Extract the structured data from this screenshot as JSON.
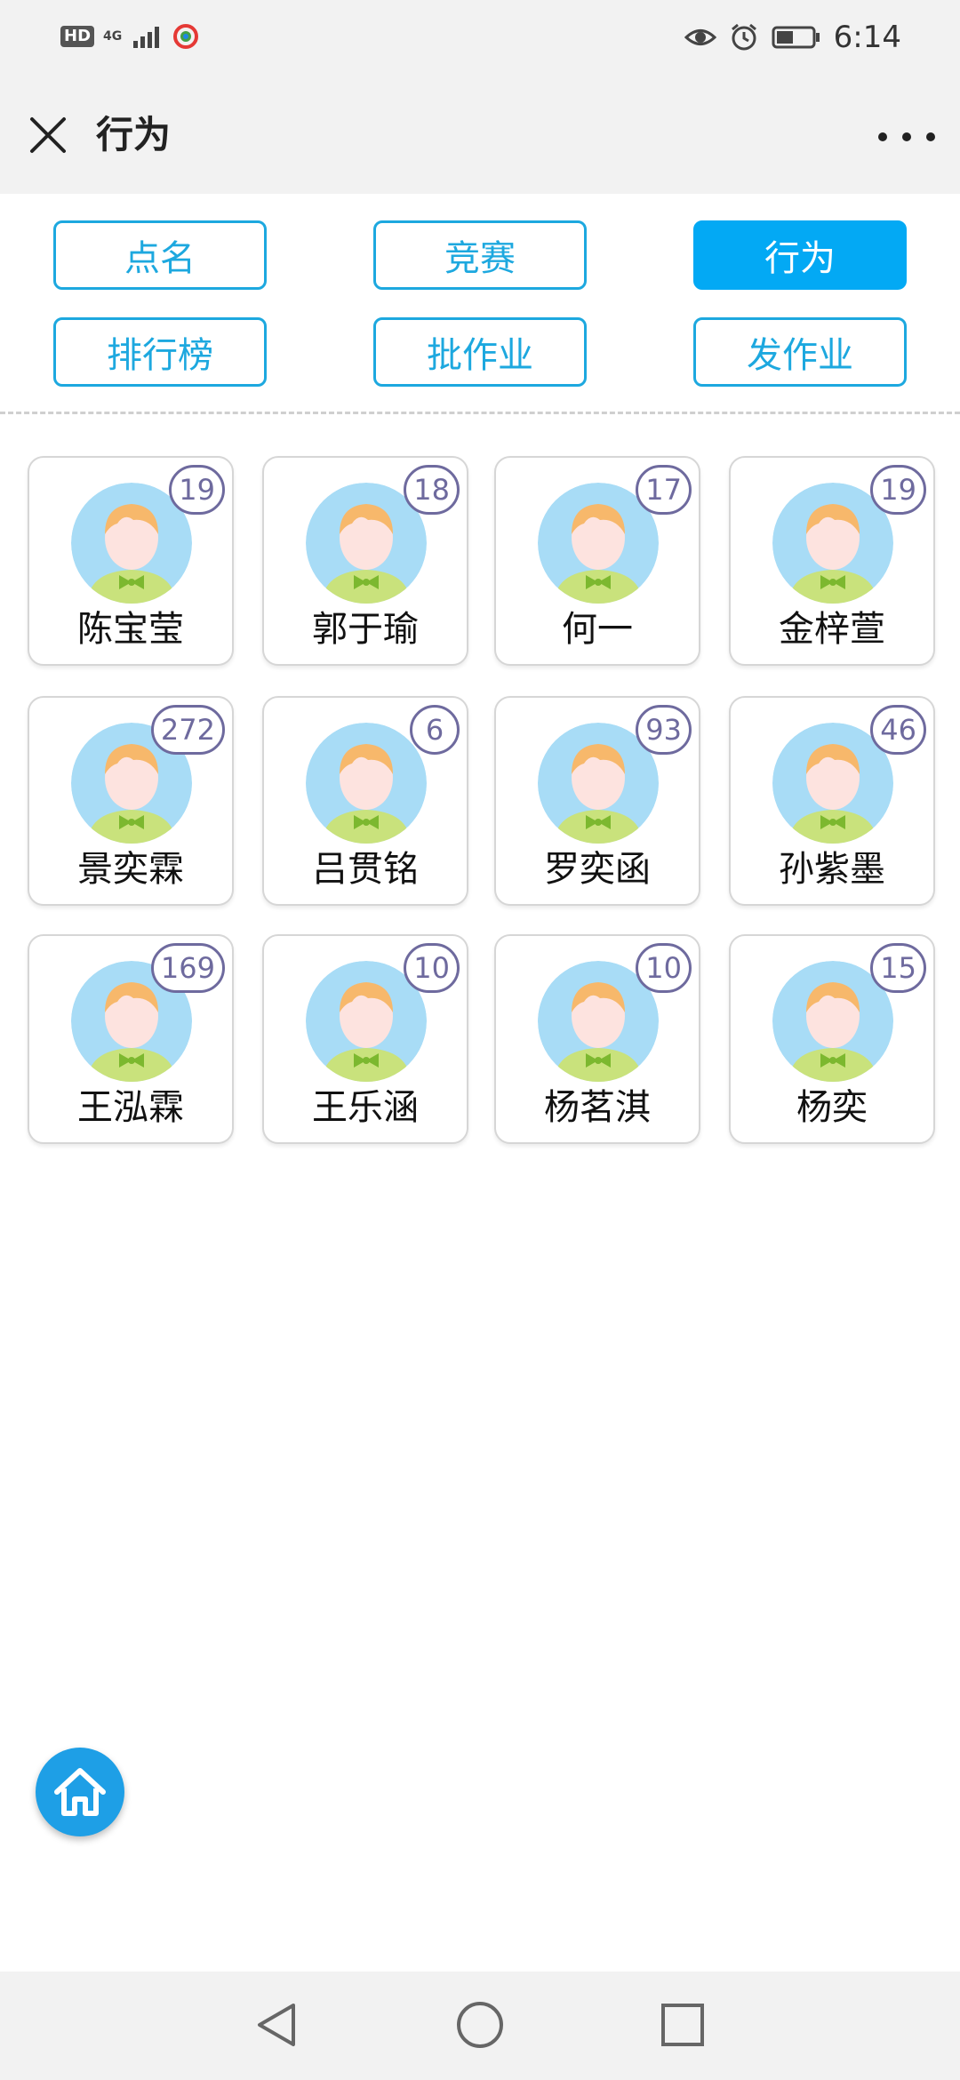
{
  "status_bar": {
    "hd": "HD",
    "network": "4G",
    "time": "6:14",
    "icons": [
      "signal-icon",
      "app-notification-icon",
      "eye-icon",
      "alarm-icon",
      "battery-icon"
    ]
  },
  "header": {
    "title": "行为",
    "close_icon": "close-icon",
    "more_icon": "more-icon"
  },
  "nav_buttons": [
    {
      "label": "点名",
      "active": false
    },
    {
      "label": "竞赛",
      "active": false
    },
    {
      "label": "行为",
      "active": true
    },
    {
      "label": "排行榜",
      "active": false
    },
    {
      "label": "批作业",
      "active": false
    },
    {
      "label": "发作业",
      "active": false
    }
  ],
  "students": [
    {
      "name": "陈宝莹",
      "count": "19"
    },
    {
      "name": "郭于瑜",
      "count": "18"
    },
    {
      "name": "何一",
      "count": "17"
    },
    {
      "name": "金梓萱",
      "count": "19"
    },
    {
      "name": "景奕霖",
      "count": "272"
    },
    {
      "name": "吕贯铭",
      "count": "6"
    },
    {
      "name": "罗奕函",
      "count": "93"
    },
    {
      "name": "孙紫墨",
      "count": "46"
    },
    {
      "name": "王泓霖",
      "count": "169"
    },
    {
      "name": "王乐涵",
      "count": "10"
    },
    {
      "name": "杨茗淇",
      "count": "10"
    },
    {
      "name": "杨奕",
      "count": "15"
    }
  ],
  "colors": {
    "accent": "#03a9f4",
    "outline": "#1da8df",
    "badge": "#6e6a9e",
    "avatar_bg": "#a8dcf6",
    "hair": "#f7b86b",
    "shirt": "#c9e27c",
    "bow": "#7cb82f"
  },
  "fab": {
    "icon": "home-icon"
  },
  "system_nav": {
    "icons": [
      "back-icon",
      "home-circle-icon",
      "recents-icon"
    ]
  }
}
